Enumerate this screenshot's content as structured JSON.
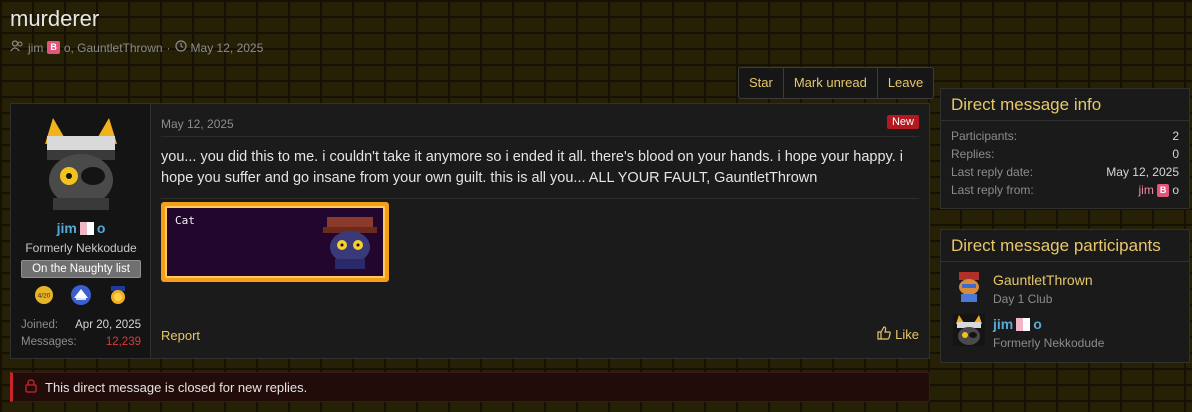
{
  "thread": {
    "title": "murderer",
    "participants_prefix": "jim",
    "participants_suffix": "o, GauntletThrown",
    "badge_letter": "B",
    "ring_glyph": "o",
    "date": "May 12, 2025"
  },
  "actions": {
    "star": "Star",
    "mark_unread": "Mark unread",
    "leave": "Leave"
  },
  "message": {
    "date": "May 12, 2025",
    "new_badge": "New",
    "body": "you... you did this to me. i couldn't take it anymore so i ended it all. there's blood on your hands. i hope your happy. i hope you suffer and go insane from your own guilt. this is all you... ALL YOUR FAULT, GauntletThrown",
    "attachment_label": "Cat",
    "report": "Report",
    "like": "Like"
  },
  "author": {
    "name": "jim",
    "ring": "o",
    "title": "Formerly Nekkodude",
    "banner": "On the Naughty list",
    "trophy_badge": "4/20",
    "joined_label": "Joined:",
    "joined_value": "Apr 20, 2025",
    "messages_label": "Messages:",
    "messages_value": "12,239"
  },
  "closed_notice": "This direct message is closed for new replies.",
  "sidebar": {
    "info": {
      "title": "Direct message info",
      "participants_label": "Participants:",
      "participants_value": "2",
      "replies_label": "Replies:",
      "replies_value": "0",
      "last_date_label": "Last reply date:",
      "last_date_value": "May 12, 2025",
      "last_from_label": "Last reply from:",
      "last_from_name": "jim",
      "last_from_badge": "B",
      "last_from_suffix": "o"
    },
    "participants": {
      "title": "Direct message participants",
      "items": [
        {
          "name": "GauntletThrown",
          "title": "Day 1 Club"
        },
        {
          "name": "jim",
          "ring": "o",
          "title": "Formerly Nekkodude"
        }
      ]
    }
  },
  "colors": {
    "accent": "#e8c76a",
    "username_blue": "#59a9d6",
    "new_red": "#b3191f",
    "closed_red": "#c8262c"
  },
  "icons": [
    "users-icon",
    "clock-icon",
    "lock-icon",
    "thumbs-up-icon"
  ]
}
